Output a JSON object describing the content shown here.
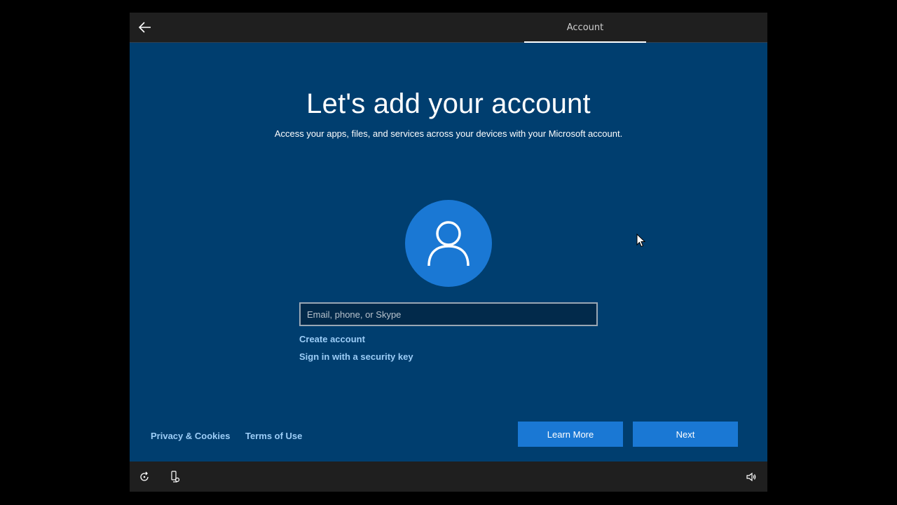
{
  "topbar": {
    "tab_label": "Account"
  },
  "main": {
    "title": "Let's add your account",
    "subtitle": "Access your apps, files, and services across your devices with your Microsoft account.",
    "input_placeholder": "Email, phone, or Skype",
    "input_value": "",
    "create_account_label": "Create account",
    "security_key_label": "Sign in with a security key"
  },
  "footer": {
    "privacy_label": "Privacy & Cookies",
    "terms_label": "Terms of Use",
    "learn_more_label": "Learn More",
    "next_label": "Next"
  },
  "icons": {
    "back": "back-arrow-icon",
    "avatar": "user-icon",
    "ease_of_access": "ease-of-access-icon",
    "accessibility": "narrator-icon",
    "volume": "volume-icon"
  },
  "colors": {
    "background": "#003e6f",
    "accent": "#1a78d4",
    "link": "#9ccdf7",
    "bar": "#1f1f1f"
  }
}
